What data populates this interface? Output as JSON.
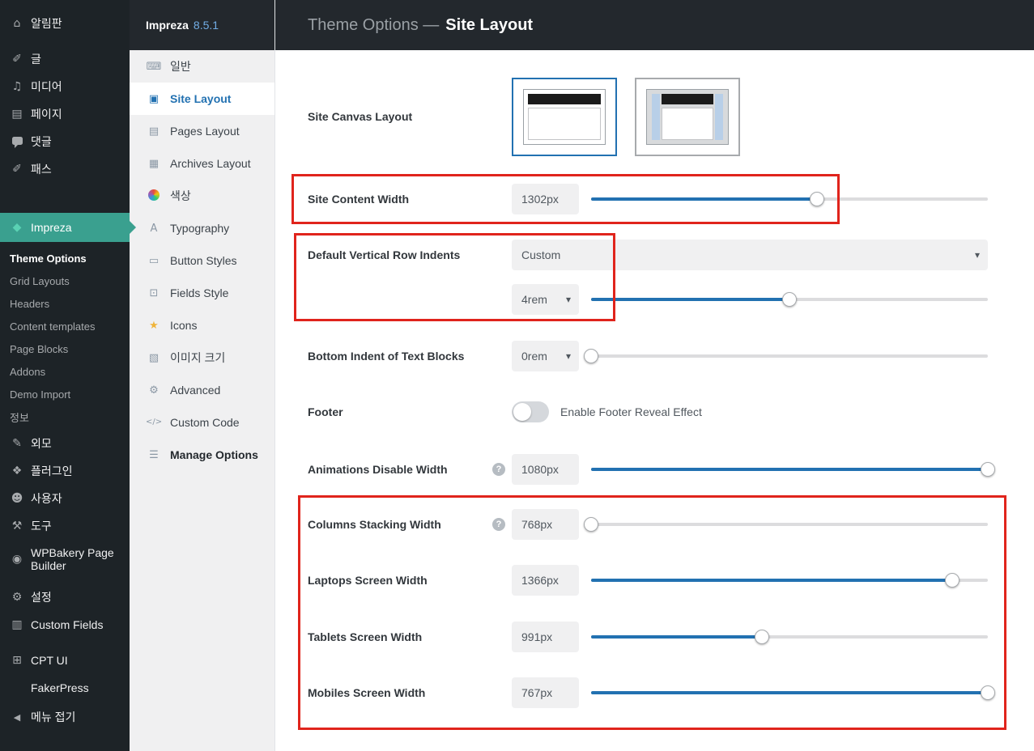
{
  "colors": {
    "accent_blue": "#2271b1",
    "impreza_teal": "#3aa08f",
    "gem_green": "#5ad1b3",
    "version_blue": "#72aee6",
    "annotation_red": "#e0241c",
    "star_yellow": "#efb43a"
  },
  "icons": {
    "help_glyph": "?",
    "chevron_glyph": "▾"
  },
  "admin_sidebar": {
    "items": [
      {
        "label": "알림판",
        "icon": "dashboard-icon",
        "glyph": "⌂"
      },
      {
        "label": "글",
        "icon": "pin-icon",
        "glyph": "✐"
      },
      {
        "label": "미디어",
        "icon": "media-icon",
        "glyph": "♫"
      },
      {
        "label": "페이지",
        "icon": "pages-icon",
        "glyph": "▤"
      },
      {
        "label": "댓글",
        "icon": "comments-icon",
        "glyph": ""
      },
      {
        "label": "패스",
        "icon": "pin-icon",
        "glyph": "✐"
      },
      {
        "label": "Impreza",
        "icon": "gem-icon",
        "glyph": "◆",
        "active": true
      },
      {
        "label": "외모",
        "icon": "appearance-icon",
        "glyph": "✎"
      },
      {
        "label": "플러그인",
        "icon": "plugins-icon",
        "glyph": "❖"
      },
      {
        "label": "사용자",
        "icon": "users-icon",
        "glyph": "☻"
      },
      {
        "label": "도구",
        "icon": "tools-icon",
        "glyph": "⚒"
      },
      {
        "label": "WPBakery Page Builder",
        "icon": "wpbakery-icon",
        "glyph": "◉"
      },
      {
        "label": "설정",
        "icon": "settings-icon",
        "glyph": "⚙"
      },
      {
        "label": "Custom Fields",
        "icon": "custom-fields-icon",
        "glyph": "▥"
      },
      {
        "label": "CPT UI",
        "icon": "cpt-ui-icon",
        "glyph": "⊞"
      },
      {
        "label": "FakerPress",
        "icon": "fakerpress-icon",
        "glyph": ""
      },
      {
        "label": "메뉴 접기",
        "icon": "collapse-menu-icon",
        "glyph": "◀"
      }
    ],
    "impreza_submenu": [
      "Theme Options",
      "Grid Layouts",
      "Headers",
      "Content templates",
      "Page Blocks",
      "Addons",
      "Demo Import",
      "정보"
    ]
  },
  "theme_sidebar": {
    "title": "Impreza",
    "version": "8.5.1",
    "items": [
      {
        "label": "일반",
        "icon": "general-icon",
        "glyph": "⌨"
      },
      {
        "label": "Site Layout",
        "icon": "site-layout-icon",
        "glyph": "▣",
        "active": true
      },
      {
        "label": "Pages Layout",
        "icon": "pages-layout-icon",
        "glyph": "▤"
      },
      {
        "label": "Archives Layout",
        "icon": "archives-layout-icon",
        "glyph": "▦"
      },
      {
        "label": "색상",
        "icon": "colors-icon",
        "glyph": ""
      },
      {
        "label": "Typography",
        "icon": "typography-icon",
        "glyph": "A"
      },
      {
        "label": "Button Styles",
        "icon": "button-styles-icon",
        "glyph": "▭"
      },
      {
        "label": "Fields Style",
        "icon": "fields-style-icon",
        "glyph": "⊡"
      },
      {
        "label": "Icons",
        "icon": "star-icon",
        "glyph": "★"
      },
      {
        "label": "이미지 크기",
        "icon": "image-sizes-icon",
        "glyph": "▧"
      },
      {
        "label": "Advanced",
        "icon": "gear-icon",
        "glyph": "⚙"
      },
      {
        "label": "Custom Code",
        "icon": "code-icon",
        "glyph": "</>"
      },
      {
        "label": "Manage Options",
        "icon": "manage-options-icon",
        "glyph": "☰"
      }
    ]
  },
  "topbar": {
    "prefix": "Theme Options —",
    "title": "Site Layout"
  },
  "options": {
    "site_canvas_layout": {
      "label": "Site Canvas Layout",
      "choices": [
        {
          "name": "wide",
          "selected": true
        },
        {
          "name": "boxed",
          "selected": false
        }
      ]
    },
    "site_content_width": {
      "label": "Site Content Width",
      "value": "1302px",
      "fill": "57%"
    },
    "row_indents": {
      "label": "Default Vertical Row Indents",
      "mode": "Custom",
      "value": "4rem",
      "fill": "50%"
    },
    "bottom_indent": {
      "label": "Bottom Indent of Text Blocks",
      "value": "0rem",
      "fill": "0%"
    },
    "footer": {
      "label": "Footer",
      "toggle_label": "Enable Footer Reveal Effect",
      "enabled": false
    },
    "animations_disable_width": {
      "label": "Animations Disable Width",
      "value": "1080px",
      "fill": "100%"
    },
    "columns_stacking_width": {
      "label": "Columns Stacking Width",
      "value": "768px",
      "fill": "0%"
    },
    "laptops_screen_width": {
      "label": "Laptops Screen Width",
      "value": "1366px",
      "fill": "91%"
    },
    "tablets_screen_width": {
      "label": "Tablets Screen Width",
      "value": "991px",
      "fill": "43%"
    },
    "mobiles_screen_width": {
      "label": "Mobiles Screen Width",
      "value": "767px",
      "fill": "100%"
    }
  }
}
